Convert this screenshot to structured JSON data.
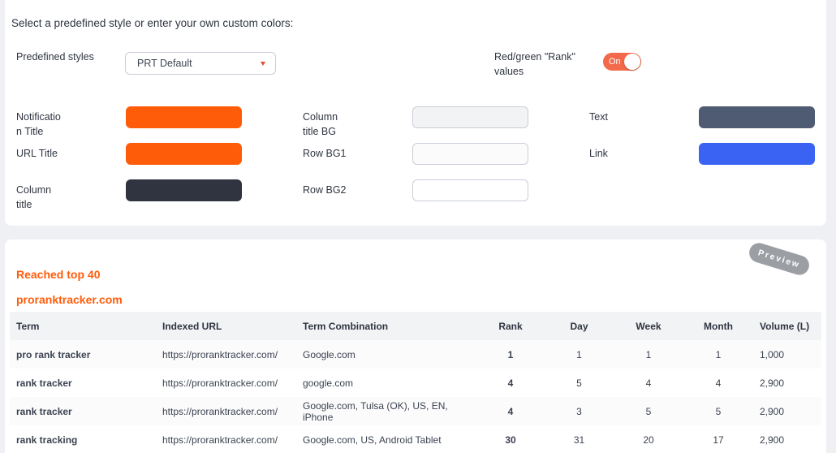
{
  "settings": {
    "intro": "Select a predefined style or enter your own custom colors:",
    "predefined_label": "Predefined styles",
    "predefined_value": "PRT Default",
    "rank_toggle_label_line1": "Red/green \"Rank\"",
    "rank_toggle_label_line2": "values",
    "rank_toggle_state": "On",
    "colors": {
      "notification_title": {
        "label_line1": "Notificatio",
        "label_line2": "n Title",
        "value": "#ff5c0a"
      },
      "url_title": {
        "label": "URL Title",
        "value": "#ff5c0a"
      },
      "column_title": {
        "label_line1": "Column",
        "label_line2": "title",
        "value": "#2f3440"
      },
      "column_title_bg": {
        "label_line1": "Column",
        "label_line2": "title BG",
        "value": "#f2f3f5"
      },
      "row_bg1": {
        "label": "Row BG1",
        "value": "#fbfbfc"
      },
      "row_bg2": {
        "label": "Row BG2",
        "value": "#ffffff"
      },
      "text": {
        "label": "Text",
        "value": "#4f5b72"
      },
      "link": {
        "label": "Link",
        "value": "#3a63f4"
      }
    }
  },
  "preview": {
    "badge": "Preview",
    "notification_title": "Reached top 40",
    "url_title": "proranktracker.com",
    "columns": [
      "Term",
      "Indexed URL",
      "Term Combination",
      "Rank",
      "Day",
      "Week",
      "Month",
      "Volume (L)"
    ],
    "rows": [
      {
        "term": "pro rank tracker",
        "url": "https://proranktracker.com/",
        "combination": "Google.com",
        "rank": "1",
        "rank_status": "neutral",
        "day": "1",
        "week": "1",
        "month": "1",
        "volume": "1,000"
      },
      {
        "term": "rank tracker",
        "url": "https://proranktracker.com/",
        "combination": "google.com",
        "rank": "4",
        "rank_status": "up",
        "day": "5",
        "week": "4",
        "month": "4",
        "volume": "2,900"
      },
      {
        "term": "rank tracker",
        "url": "https://proranktracker.com/",
        "combination": "Google.com, Tulsa (OK), US, EN, iPhone",
        "rank": "4",
        "rank_status": "down",
        "day": "3",
        "week": "5",
        "month": "5",
        "volume": "2,900"
      },
      {
        "term": "rank tracking",
        "url": "https://proranktracker.com/",
        "combination": "Google.com, US, Android Tablet",
        "rank": "30",
        "rank_status": "up",
        "day": "31",
        "week": "20",
        "month": "17",
        "volume": "2,900"
      }
    ]
  }
}
